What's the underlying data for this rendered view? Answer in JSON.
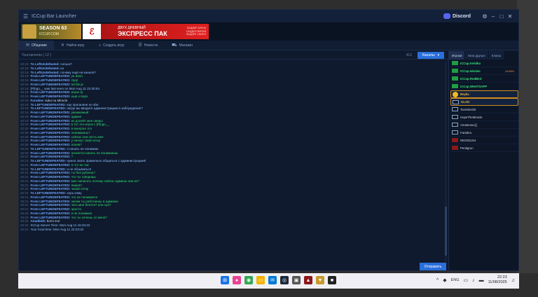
{
  "window": {
    "title": "ICCup Bar Launcher",
    "discord_label": "Discord",
    "controls": [
      "⚙",
      "–",
      "□",
      "✕"
    ]
  },
  "banners": {
    "season_title": "SEASON 63",
    "season_sub": "ICCUP.COM",
    "express_title": "ЭКСПРЕСС ПАК",
    "express_pre": "ДВУХ ДНЕВНЫЙ",
    "express_right": [
      "ЛАДДЕР АРЕНА",
      "ЛАДДЕР ВРЕМЯ",
      "ЛАДДЕР СКИЛЛ"
    ]
  },
  "tabs": [
    {
      "icon": "chat-icon",
      "glyph": "✉",
      "label": "Общение"
    },
    {
      "icon": "find-icon",
      "glyph": "✕",
      "label": "Найти игру"
    },
    {
      "icon": "create-icon",
      "glyph": "⌂",
      "label": "Создать игру"
    },
    {
      "icon": "news-icon",
      "glyph": "☰",
      "label": "Новости"
    },
    {
      "icon": "shop-icon",
      "glyph": "⛟",
      "label": "Магазин"
    }
  ],
  "channel": {
    "name": "Tournaments ( 12 )",
    "users_count": "412",
    "channels_button": "Каналы",
    "send_button": "Отправить"
  },
  "chat": [
    {
      "ts": "22:19",
      "from": "To LeftUndefeated:",
      "text": "сельск?",
      "c": "msg-blue"
    },
    {
      "ts": "22:19",
      "from": "To LeftUndefeated:",
      "text": "ка",
      "c": "msg-blue"
    },
    {
      "ts": "22:19",
      "from": "To LeftUndefeated:",
      "text": "почему ещё на канале?",
      "c": "msg-blue"
    },
    {
      "ts": "22:19",
      "from": "From LEFTUNDEFEATED:",
      "text": "ye dann",
      "c": "msg-green"
    },
    {
      "ts": "22:19",
      "from": "From LEFTUNDEFEATED:",
      "text": "ctyq!",
      "c": "msg-green"
    },
    {
      "ts": "22:19",
      "from": "From LEFTUNDEFEATED:",
      "text": "tot ble je",
      "c": "msg-green"
    },
    {
      "ts": "22:19",
      "from": "",
      "text": "[P]ngo__ was last seen on Mon Aug 11 22:30:54",
      "c": "msg-blue"
    },
    {
      "ts": "22:19",
      "from": "From LEFTUNDEFEATED:",
      "text": "игрок а)",
      "c": "msg-green"
    },
    {
      "ts": "22:19",
      "from": "From LEFTUNDEFEATED:",
      "text": "ещё к перо",
      "c": "msg-green"
    },
    {
      "ts": "22:19",
      "from": "Faradеи:",
      "text": "suka na Miracle",
      "c": "msg-white"
    },
    {
      "ts": "22:19",
      "from": "To LEFTUNDEFEATED:",
      "text": "кау проганяне но sbe",
      "c": "msg-blue"
    },
    {
      "ts": "22:19",
      "from": "To LEFTUNDEFEATED:",
      "text": "нигде вы вводите администрацию в заблуждение?",
      "c": "msg-blue"
    },
    {
      "ts": "22:19",
      "from": "From LEFTUNDEFEATED:",
      "text": "уважаемый",
      "c": "msg-green"
    },
    {
      "ts": "22:19",
      "from": "From LEFTUNDEFEATED:",
      "text": "админ!",
      "c": "msg-green"
    },
    {
      "ts": "22:19",
      "from": "From LEFTUNDEFEATED:",
      "text": "из длоейт мне сверы",
      "c": "msg-green"
    },
    {
      "ts": "22:19",
      "from": "From LEFTUNDEFEATED:",
      "text": "в тот это игрок с [P]ngo__",
      "c": "msg-green"
    },
    {
      "ts": "22:20",
      "from": "From LEFTUNDEFEATED:",
      "text": "в выиграл это",
      "c": "msg-green"
    },
    {
      "ts": "22:20",
      "from": "From LEFTUNDEFEATED:",
      "text": "понимаешь?",
      "c": "msg-green"
    },
    {
      "ts": "22:20",
      "from": "From LEFTUNDEFEATED:",
      "text": "сейчас они сесть мне",
      "c": "msg-green"
    },
    {
      "ts": "22:20",
      "from": "From LEFTUNDEFEATED:",
      "text": "у начнут свой сетку",
      "c": "msg-green"
    },
    {
      "ts": "22:20",
      "from": "From LEFTUNDEFEATED:",
      "text": "поняв?",
      "c": "msg-green"
    },
    {
      "ts": "22:20",
      "from": "To LEFTUNDEFEATED:",
      "text": "я начать не понимаю",
      "c": "msg-blue"
    },
    {
      "ts": "22:20",
      "from": "From LEFTUNDEFEATED:",
      "text": "начнется начать не понимаешь",
      "c": "msg-green"
    },
    {
      "ts": "22:21",
      "from": "From LEFTUNDEFEATED:",
      "text": "?",
      "c": "msg-green"
    },
    {
      "ts": "22:21",
      "from": "To LEFTUNDEFEATED:",
      "text": "нужно знать правильно общаться с администрацией",
      "c": "msg-blue"
    },
    {
      "ts": "22:21",
      "from": "From LEFTUNDEFEATED:",
      "text": "я что не так",
      "c": "msg-green"
    },
    {
      "ts": "22:21",
      "from": "To LEFTUNDEFEATED:",
      "text": "и не обзываться",
      "c": "msg-blue"
    },
    {
      "ts": "22:21",
      "from": "From LEFTUNDEFEATED:",
      "text": "ты бля рублеш?",
      "c": "msg-green"
    },
    {
      "ts": "22:21",
      "from": "From LEFTUNDEFEATED:",
      "text": "что ты говоришь",
      "c": "msg-green"
    },
    {
      "ts": "22:21",
      "from": "From LEFTUNDEFEATED:",
      "text": "мне написать почему сейчас админы они их?",
      "c": "msg-green"
    },
    {
      "ts": "22:21",
      "from": "From LEFTUNDEFEATED:",
      "text": "пиши!!!",
      "c": "msg-green"
    },
    {
      "ts": "22:21",
      "from": "From LEFTUNDEFEATED:",
      "text": "чекай сетку",
      "c": "msg-green"
    },
    {
      "ts": "22:21",
      "from": "To LEFTUNDEFEATED:",
      "text": "хорь кому",
      "c": "msg-blue"
    },
    {
      "ts": "22:21",
      "from": "From LEFTUNDEFEATED:",
      "text": "что не понимаете",
      "c": "msg-green"
    },
    {
      "ts": "22:21",
      "from": "From LEFTUNDEFEATED:",
      "text": "зачем ты работаешь в админке",
      "c": "msg-green"
    },
    {
      "ts": "22:21",
      "from": "From LEFTUNDEFEATED:",
      "text": "чего мне блятся? или хуя?",
      "c": "msg-green"
    },
    {
      "ts": "22:21",
      "from": "From LEFTUNDEFEATED:",
      "text": "просто",
      "c": "msg-green"
    },
    {
      "ts": "22:22",
      "from": "From LEFTUNDEFEATED:",
      "text": "я не понимаю",
      "c": "msg-green"
    },
    {
      "ts": "22:22",
      "from": "From LEFTUNDEFEATED:",
      "text": "что ты хочешь от меня?",
      "c": "msg-green"
    },
    {
      "ts": "22:22",
      "from": "Amalbeik:",
      "text": "bomi zori",
      "c": "msg-white"
    },
    {
      "ts": "22:22",
      "from": "",
      "text": "ICCup Server Time: Mon Aug 11 16:23:22",
      "c": "msg-blue"
    },
    {
      "ts": "22:22",
      "from": "",
      "text": "Your local time: Mon Aug 11 22:23:22",
      "c": "msg-blue"
    }
  ],
  "side": {
    "tabs": [
      "Игроки",
      "Мои друзья",
      "Кланы"
    ],
    "users": [
      {
        "name": "ICCup.Kelvlko",
        "style": "nm-green",
        "flag": "",
        "extra": ""
      },
      {
        "name": "ICCup.Iskulan",
        "style": "nm-green",
        "flag": "",
        "extra": "ADMIN"
      },
      {
        "name": "ICCup.RedBird",
        "style": "nm-green",
        "flag": "",
        "extra": ""
      },
      {
        "name": "ICCup.WHATSAPP",
        "style": "nm-green",
        "flag": "",
        "extra": ""
      },
      {
        "name": "Beyka",
        "style": "nm-yellow",
        "flag": "coin",
        "extra": "",
        "hl": true
      },
      {
        "name": "GLAD",
        "style": "nm-yellow",
        "flag": "sq",
        "extra": "",
        "hl": true
      },
      {
        "name": "Toxinsleshit",
        "style": "nm-white",
        "flag": "sq",
        "extra": ""
      },
      {
        "name": "HopeTheMiracle",
        "style": "nm-white",
        "flag": "sq",
        "extra": ""
      },
      {
        "name": "Amaterasu[.]",
        "style": "nm-white",
        "flag": "sq",
        "extra": ""
      },
      {
        "name": "Faradeu",
        "style": "nm-white",
        "flag": "sq",
        "extra": ""
      },
      {
        "name": "NEOSDJ54",
        "style": "nm-white",
        "flag": "red",
        "extra": ""
      },
      {
        "name": "Peralgrun",
        "style": "nm-white",
        "flag": "red",
        "extra": ""
      }
    ]
  },
  "taskbar": {
    "lang": "ENG",
    "time": "22:23",
    "date": "11/08/2025"
  }
}
